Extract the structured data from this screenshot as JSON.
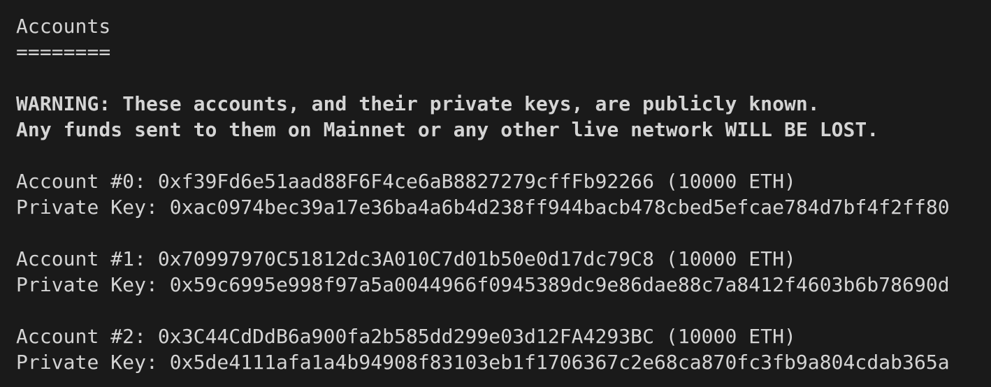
{
  "heading": "Accounts",
  "underline": "========",
  "warning": [
    "WARNING: These accounts, and their private keys, are publicly known.",
    "Any funds sent to them on Mainnet or any other live network WILL BE LOST."
  ],
  "accounts": [
    {
      "line": "Account #0: 0xf39Fd6e51aad88F6F4ce6aB8827279cffFb92266 (10000 ETH)",
      "key": "Private Key: 0xac0974bec39a17e36ba4a6b4d238ff944bacb478cbed5efcae784d7bf4f2ff80"
    },
    {
      "line": "Account #1: 0x70997970C51812dc3A010C7d01b50e0d17dc79C8 (10000 ETH)",
      "key": "Private Key: 0x59c6995e998f97a5a0044966f0945389dc9e86dae88c7a8412f4603b6b78690d"
    },
    {
      "line": "Account #2: 0x3C44CdDdB6a900fa2b585dd299e03d12FA4293BC (10000 ETH)",
      "key": "Private Key: 0x5de4111afa1a4b94908f83103eb1f1706367c2e68ca870fc3fb9a804cdab365a"
    }
  ]
}
